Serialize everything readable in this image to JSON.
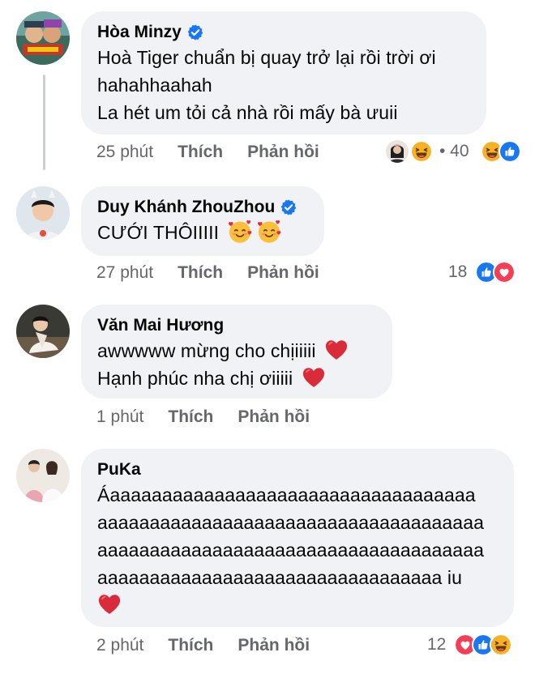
{
  "comments": [
    {
      "name": "Hòa Minzy",
      "verified": true,
      "lines": [
        "Hoà Tiger chuẩn bị quay trở lại rồi trời ơi",
        "hahahhaahah",
        "La hét um tỏi cả nhà rồi mấy bà ưuii"
      ],
      "time": "25 phút",
      "like": "Thích",
      "reply": "Phản hồi",
      "reaction_count": "40",
      "reaction_prefix_count": "• 40"
    },
    {
      "name": "Duy Khánh ZhouZhou",
      "verified": true,
      "lines": [
        "CƯỚI THÔIIIII"
      ],
      "time": "27 phút",
      "like": "Thích",
      "reply": "Phản hồi",
      "reaction_count": "18"
    },
    {
      "name": "Văn Mai Hương",
      "verified": false,
      "lines": [
        "awwwww mừng cho chịiiiii",
        "Hạnh phúc nha chị ơiiiii"
      ],
      "time": "1 phút",
      "like": "Thích",
      "reply": "Phản hồi"
    },
    {
      "name": "PuKa",
      "verified": false,
      "lines": [
        "Áaaaaaaaaaaaaaaaaaaaaaaaaaaaaaaaaaaa",
        "aaaaaaaaaaaaaaaaaaaaaaaaaaaaaaaaaaaaa",
        "aaaaaaaaaaaaaaaaaaaaaaaaaaaaaaaaaaaaa",
        "aaaaaaaaaaaaaaaaaaaaaaaaaaaaaaaaa iu"
      ],
      "time": "2 phút",
      "like": "Thích",
      "reply": "Phản hồi",
      "reaction_count": "12"
    }
  ],
  "icons": {
    "verified": "verified-badge-icon",
    "like": "like-reaction-icon",
    "love": "love-reaction-icon",
    "haha": "haha-reaction-icon",
    "heart": "red-heart-emoji",
    "smile_hearts": "smiling-face-with-hearts-emoji"
  },
  "colors": {
    "bubble": "#f0f2f5",
    "meta": "#65676b",
    "verified": "#1877f2",
    "like": "#1877f2",
    "love": "#f33e58",
    "haha": "#f7b125"
  }
}
